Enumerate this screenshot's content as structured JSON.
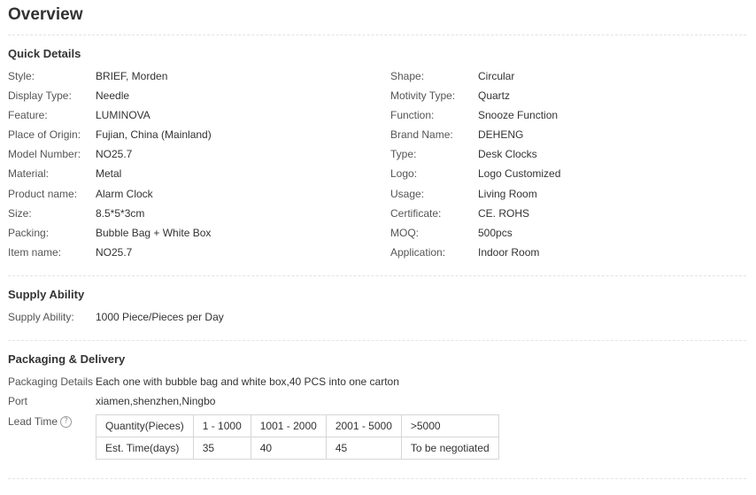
{
  "title": "Overview",
  "quick_details": {
    "heading": "Quick Details",
    "left": [
      {
        "label": "Style:",
        "value": "BRIEF, Morden"
      },
      {
        "label": "Display Type:",
        "value": "Needle"
      },
      {
        "label": "Feature:",
        "value": "LUMINOVA"
      },
      {
        "label": "Place of Origin:",
        "value": "Fujian, China (Mainland)"
      },
      {
        "label": "Model Number:",
        "value": "NO25.7"
      },
      {
        "label": "Material:",
        "value": "Metal"
      },
      {
        "label": "Product name:",
        "value": "Alarm Clock"
      },
      {
        "label": "Size:",
        "value": "8.5*5*3cm"
      },
      {
        "label": "Packing:",
        "value": "Bubble Bag + White Box"
      },
      {
        "label": "Item name:",
        "value": "NO25.7"
      }
    ],
    "right": [
      {
        "label": "Shape:",
        "value": "Circular"
      },
      {
        "label": "Motivity Type:",
        "value": "Quartz"
      },
      {
        "label": "Function:",
        "value": "Snooze Function"
      },
      {
        "label": "Brand Name:",
        "value": "DEHENG"
      },
      {
        "label": "Type:",
        "value": "Desk Clocks"
      },
      {
        "label": "Logo:",
        "value": "Logo Customized"
      },
      {
        "label": "Usage:",
        "value": "Living Room"
      },
      {
        "label": "Certificate:",
        "value": "CE. ROHS"
      },
      {
        "label": "MOQ:",
        "value": "500pcs"
      },
      {
        "label": "Application:",
        "value": "Indoor Room"
      }
    ]
  },
  "supply": {
    "heading": "Supply Ability",
    "label": "Supply Ability:",
    "value": "1000 Piece/Pieces per Day"
  },
  "packaging": {
    "heading": "Packaging & Delivery",
    "details_label": "Packaging Details",
    "details_value": "Each one with bubble bag and white box,40 PCS into one carton",
    "port_label": "Port",
    "port_value": "xiamen,shenzhen,Ningbo",
    "lead_time_label": "Lead Time",
    "lead_time_icon": "help-icon",
    "lead_table": {
      "quantity_row": [
        "Quantity(Pieces)",
        "1 - 1000",
        "1001 - 2000",
        "2001 - 5000",
        ">5000"
      ],
      "time_row": [
        "Est. Time(days)",
        "35",
        "40",
        "45",
        "To be negotiated"
      ]
    }
  }
}
